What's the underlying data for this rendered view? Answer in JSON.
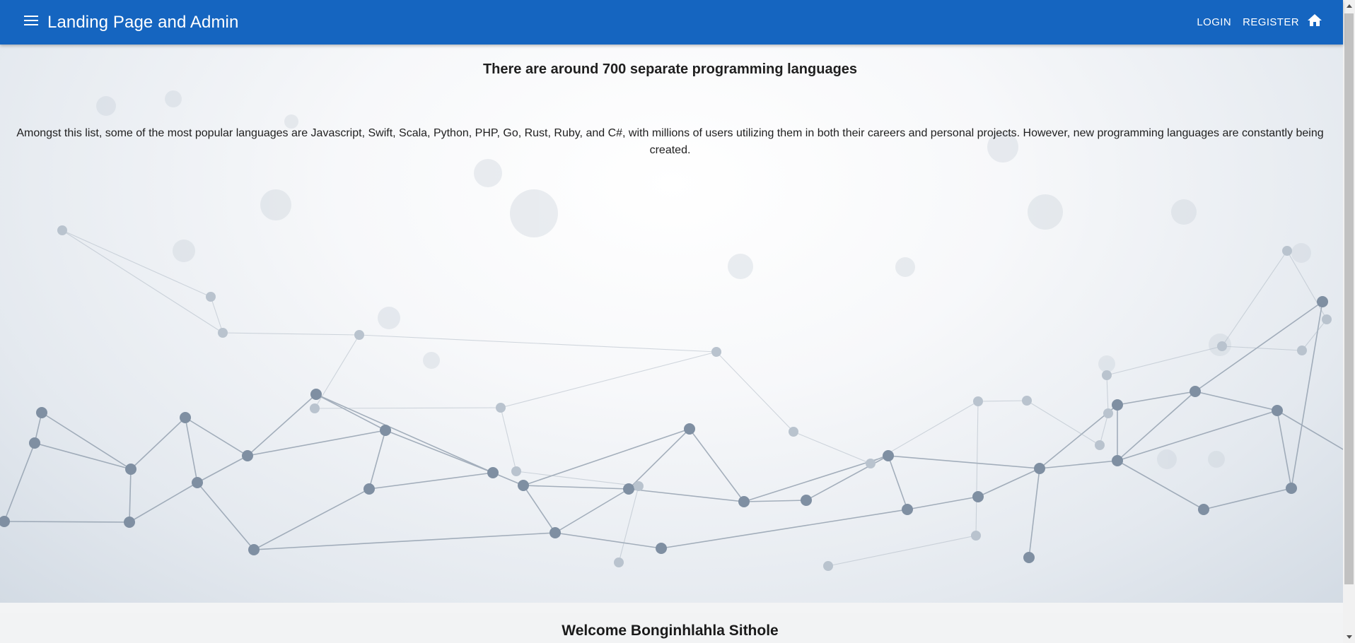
{
  "appbar": {
    "title": "Landing Page and Admin",
    "login_label": "LOGIN",
    "register_label": "REGISTER",
    "color": "#1565c0"
  },
  "hero": {
    "heading": "There are around 700 separate programming languages",
    "body": "Amongst this list, some of the most popular languages are Javascript, Swift, Scala, Python, PHP, Go, Rust, Ruby, and C#, with millions of users utilizing them in both their careers and personal projects. However, new programming languages are constantly being created."
  },
  "welcome": {
    "text": "Welcome Bonginhlahla Sithole"
  },
  "icons": {
    "menu": "menu-icon",
    "home": "home-icon"
  }
}
